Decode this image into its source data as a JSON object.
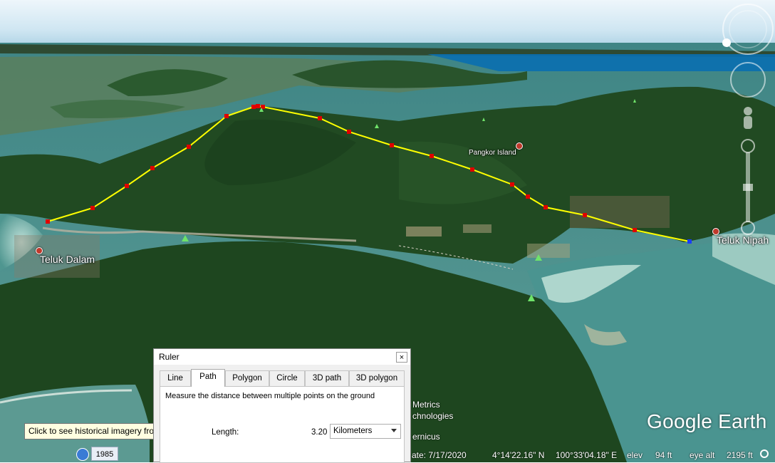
{
  "map": {
    "place_labels": {
      "teluk_dalam": "Teluk Dalam",
      "teluk_nipah": "Teluk Nipah",
      "pangkor_island": "Pangkor Island"
    },
    "attribution": {
      "line1": "Metrics",
      "line2": "chnologies",
      "line3": "ernicus"
    },
    "logo": "Google Earth",
    "path_color": "#ffff00",
    "vertex_color": "#e00000",
    "end_vertex_color": "#1a3cff"
  },
  "statusbar": {
    "imagery_date": "ate: 7/17/2020",
    "latitude": "4°14'22.16\" N",
    "longitude": "100°33'04.18\" E",
    "elev_label": "elev",
    "elev_value": "94 ft",
    "eye_alt_label": "eye alt",
    "eye_alt_value": "2195 ft"
  },
  "historical": {
    "tooltip": "Click to see historical imagery from",
    "year": "1985",
    "icon": "clock-icon"
  },
  "ruler": {
    "title": "Ruler",
    "close_glyph": "×",
    "tabs": [
      {
        "label": "Line"
      },
      {
        "label": "Path"
      },
      {
        "label": "Polygon"
      },
      {
        "label": "Circle"
      },
      {
        "label": "3D path"
      },
      {
        "label": "3D polygon"
      }
    ],
    "active_tab": "Path",
    "description": "Measure the distance between multiple points on the ground",
    "length_label": "Length:",
    "length_value": "3.20",
    "unit": "Kilometers"
  },
  "nav": {
    "compass_north": "N",
    "icons": [
      "compass-icon",
      "look-joystick-icon",
      "street-view-pegman-icon",
      "zoom-slider-icon"
    ]
  }
}
